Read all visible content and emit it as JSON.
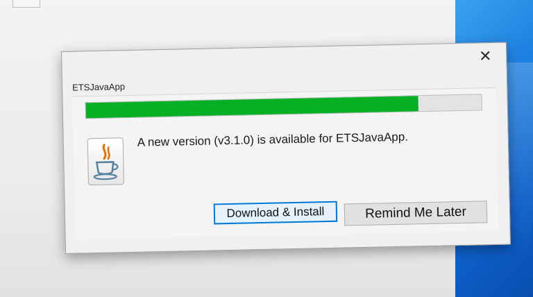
{
  "dialog": {
    "title": "ETSJavaApp",
    "close_symbol": "✕",
    "message": "A new version (v3.1.0) is available for ETSJavaApp.",
    "progress": 0.84,
    "progress_color": "#06b025",
    "icon": "java-icon",
    "buttons": {
      "download_install": "Download & Install",
      "remind_me_later": "Remind Me Later"
    }
  },
  "colors": {
    "accent": "#0078d7",
    "desktop": "#1d7fe0"
  }
}
